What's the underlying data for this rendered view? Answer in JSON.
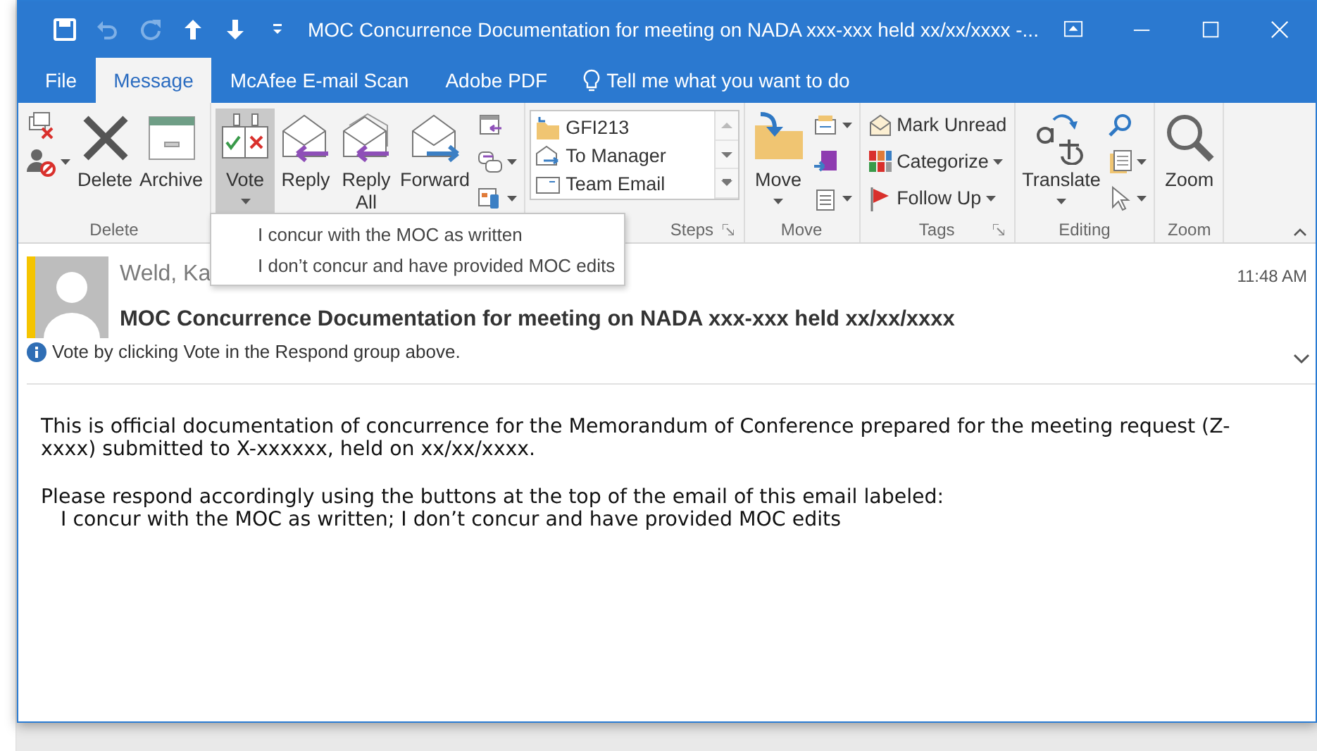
{
  "window": {
    "title": "MOC Concurrence Documentation for meeting on NADA xxx-xxx held xx/xx/xxxx  -..."
  },
  "tabs": [
    {
      "label": "File",
      "selected": false
    },
    {
      "label": "Message",
      "selected": true
    },
    {
      "label": "McAfee E-mail Scan",
      "selected": false
    },
    {
      "label": "Adobe PDF",
      "selected": false
    }
  ],
  "tell_me": "Tell me what you want to do",
  "ribbon": {
    "groups": [
      {
        "label": "Delete",
        "columns": [
          {
            "buttons": [
              {
                "kind": "small"
              },
              {
                "kind": "small",
                "dropdown": true
              }
            ]
          },
          {
            "buttons": [
              {
                "kind": "large",
                "label": "Delete",
                "expanded": false
              }
            ]
          },
          {
            "buttons": [
              {
                "kind": "large",
                "label": "Archive",
                "expanded": false
              }
            ]
          }
        ]
      },
      {
        "columns": [
          {
            "buttons": [
              {
                "kind": "large",
                "label": "Vote",
                "dropdown": true,
                "expanded": true
              }
            ]
          },
          {
            "buttons": [
              {
                "kind": "large",
                "label": "Reply",
                "expanded": false
              }
            ]
          },
          {
            "buttons": [
              {
                "kind": "large",
                "label": "Reply All",
                "expanded": false
              }
            ]
          },
          {
            "buttons": [
              {
                "kind": "large",
                "label": "Forward",
                "expanded": false
              }
            ]
          },
          {
            "buttons": [
              {
                "kind": "small"
              },
              {
                "kind": "small",
                "dropdown": true
              },
              {
                "kind": "small",
                "dropdown": true
              }
            ]
          }
        ]
      },
      {
        "label": "Steps",
        "launcher": true,
        "columns": [
          {
            "gallery": [
              "GFI213",
              "To Manager",
              "Team Email"
            ]
          }
        ]
      },
      {
        "label": "Move",
        "columns": [
          {
            "buttons": [
              {
                "kind": "large",
                "label": "Move",
                "dropdown": true,
                "expanded": false
              }
            ]
          },
          {
            "buttons": [
              {
                "kind": "small",
                "dropdown": true
              },
              {
                "kind": "small"
              },
              {
                "kind": "small",
                "dropdown": true
              }
            ]
          }
        ]
      },
      {
        "label": "Tags",
        "launcher": true,
        "columns": [
          {
            "buttons": [
              {
                "kind": "small",
                "label": "Mark Unread"
              },
              {
                "kind": "small",
                "label": "Categorize",
                "dropdown": true
              },
              {
                "kind": "small",
                "label": "Follow Up",
                "dropdown": true
              }
            ]
          }
        ]
      },
      {
        "label": "Editing",
        "columns": [
          {
            "buttons": [
              {
                "kind": "large",
                "label": "Translate",
                "dropdown": true,
                "expanded": false
              }
            ]
          },
          {
            "buttons": [
              {
                "kind": "small"
              },
              {
                "kind": "small",
                "dropdown": true
              },
              {
                "kind": "small",
                "dropdown": true
              }
            ]
          }
        ]
      },
      {
        "label": "Zoom",
        "columns": [
          {
            "buttons": [
              {
                "kind": "large",
                "label": "Zoom",
                "expanded": false
              }
            ]
          }
        ]
      }
    ]
  },
  "vote_menu": [
    "I concur with the MOC as written",
    "I don’t concur and have provided MOC edits"
  ],
  "message": {
    "sender": "Weld, Ka",
    "time": "11:48 AM",
    "subject": "MOC Concurrence Documentation for meeting on NADA xxx-xxx held xx/xx/xxxx",
    "info": "Vote by clicking Vote in the Respond group above.",
    "body": [
      "This is official documentation of concurrence for the Memorandum of Conference prepared for the meeting request (Z-xxxx) submitted to X-xxxxxx, held on xx/xx/xxxx.",
      "Please respond accordingly using the buttons at the top of the email of this email labeled:",
      "I concur with the MOC as written; I don’t concur and have provided MOC edits"
    ]
  }
}
